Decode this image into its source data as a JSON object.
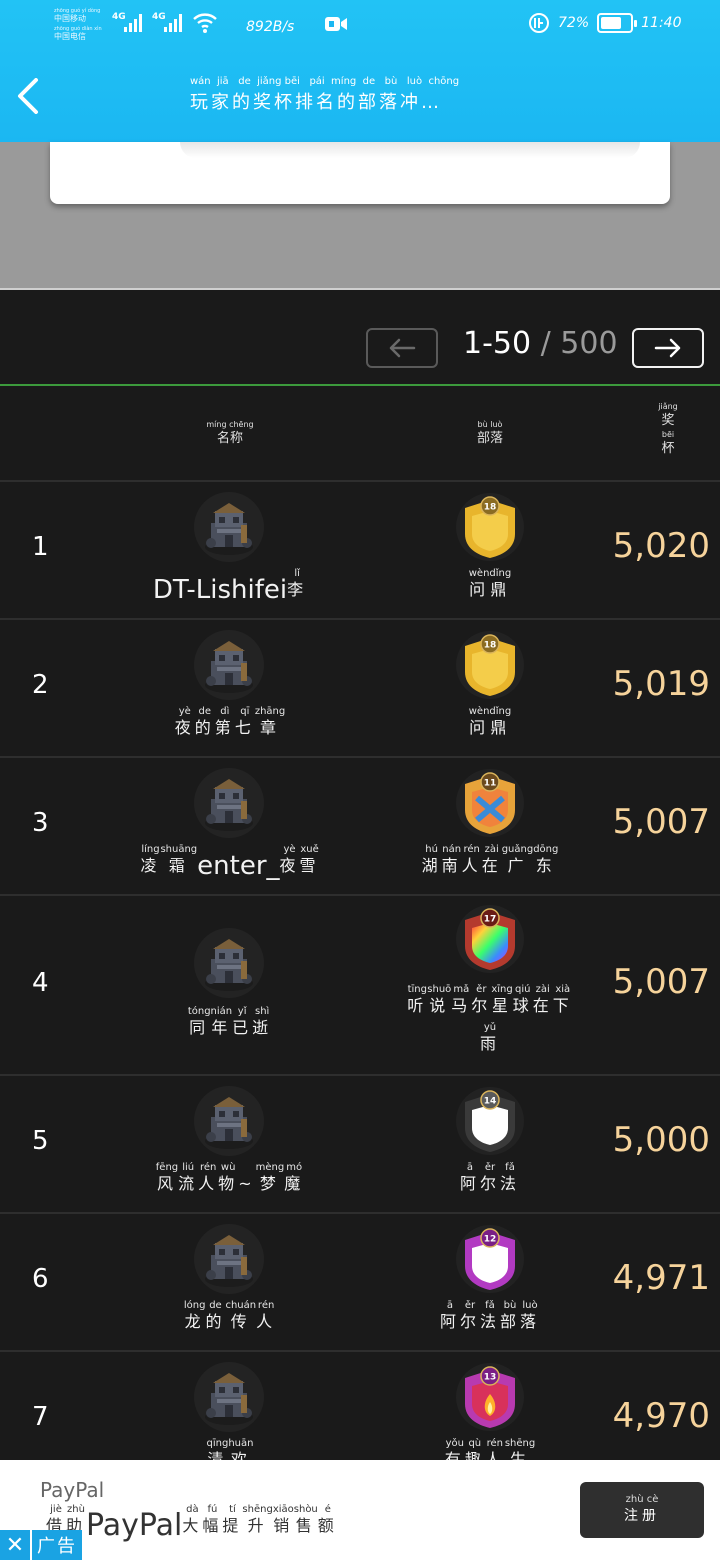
{
  "status_bar": {
    "carrier1": "中国移动",
    "carrier1_pinyin": "zhōng guó yí dòng",
    "carrier2": "中国电信",
    "carrier2_pinyin": "zhōng guó diàn xìn",
    "net1": "4G",
    "net2": "4G",
    "speed": "892B/s",
    "battery_percent": "72%",
    "battery_level": 0.72,
    "time": "11:40"
  },
  "header": {
    "title": "玩家的奖杯排名的部落冲…",
    "title_pinyin": "wán  jiā   de  jiǎng bēi   pái  míng  de   bù   luò  chōng"
  },
  "pager": {
    "range": "1-50",
    "slash": " / ",
    "total": "500"
  },
  "table": {
    "headers": {
      "name": "名称",
      "name_pinyin": "míng chēng",
      "clan": "部落",
      "clan_pinyin": "bù luò",
      "trophies_1": "奖",
      "trophies_1_pinyin": "jiǎng",
      "trophies_2": "杯",
      "trophies_2_pinyin": "bēi"
    },
    "rows": [
      {
        "rank": "1",
        "trophies": "5,020",
        "name_latin": "DT-Lishifei",
        "name_tail": "李",
        "name_tail_py": "lǐ",
        "clan_level": "18",
        "clan": [
          "问",
          "鼎"
        ],
        "clan_py": [
          "wèn",
          "dǐng"
        ]
      },
      {
        "rank": "2",
        "trophies": "5,019",
        "name": [
          "夜",
          "的",
          "第",
          "七",
          "章"
        ],
        "name_py": [
          "yè",
          "de",
          "dì",
          "qī",
          "zhāng"
        ],
        "clan_level": "18",
        "clan": [
          "问",
          "鼎"
        ],
        "clan_py": [
          "wèn",
          "dǐng"
        ]
      },
      {
        "rank": "3",
        "trophies": "5,007",
        "name_head": [
          "凌",
          "霜"
        ],
        "name_head_py": [
          "líng",
          "shuāng"
        ],
        "name_latin": "enter_",
        "name_tail2": [
          "夜",
          "雪"
        ],
        "name_tail2_py": [
          "yè",
          "xuě"
        ],
        "clan_level": "11",
        "clan": [
          "湖",
          "南",
          "人",
          "在",
          "广",
          "东"
        ],
        "clan_py": [
          "hú",
          "nán",
          "rén",
          "zài",
          "guǎng",
          "dōng"
        ]
      },
      {
        "rank": "4",
        "trophies": "5,007",
        "name": [
          "同",
          "年",
          "已",
          "逝"
        ],
        "name_py": [
          "tóng",
          "nián",
          "yǐ",
          "shì"
        ],
        "clan_level": "17",
        "clan": [
          "听",
          "说",
          "马",
          "尔",
          "星",
          "球",
          "在",
          "下"
        ],
        "clan_py": [
          "tīng",
          "shuō",
          "mǎ",
          "ěr",
          "xīng",
          "qiú",
          "zài",
          "xià"
        ],
        "clan2": [
          "雨"
        ],
        "clan2_py": [
          "yǔ"
        ]
      },
      {
        "rank": "5",
        "trophies": "5,000",
        "name": [
          "风",
          "流",
          "人",
          "物",
          "~",
          "梦",
          "魔"
        ],
        "name_py": [
          "fēng",
          "liú",
          "rén",
          "wù",
          "",
          "mèng",
          "mó"
        ],
        "clan_level": "14",
        "clan": [
          "阿",
          "尔",
          "法"
        ],
        "clan_py": [
          "ā",
          "ěr",
          "fǎ"
        ]
      },
      {
        "rank": "6",
        "trophies": "4,971",
        "name": [
          "龙",
          "的",
          "传",
          "人"
        ],
        "name_py": [
          "lóng",
          "de",
          "chuán",
          "rén"
        ],
        "clan_level": "12",
        "clan": [
          "阿",
          "尔",
          "法",
          "部",
          "落"
        ],
        "clan_py": [
          "ā",
          "ěr",
          "fǎ",
          "bù",
          "luò"
        ]
      },
      {
        "rank": "7",
        "trophies": "4,970",
        "name": [
          "清",
          "欢"
        ],
        "name_py": [
          "qīng",
          "huān"
        ],
        "clan_level": "13",
        "clan": [
          "有",
          "趣",
          "人",
          "生"
        ],
        "clan_py": [
          "yǒu",
          "qù",
          "rén",
          "shēng"
        ]
      }
    ]
  },
  "ad": {
    "title": "PayPal",
    "text_head": [
      "借",
      "助"
    ],
    "text_head_py": [
      "jiè",
      "zhù"
    ],
    "brand": "PayPal",
    "text_tail": [
      "大",
      "幅",
      "提",
      "升",
      "销",
      "售",
      "额"
    ],
    "text_tail_py": [
      "dà",
      "fú",
      "tí",
      "shēng",
      "xiāo",
      "shòu",
      "é"
    ],
    "button": "注册",
    "button_py": "zhù cè",
    "tag": "广告"
  },
  "colors": {
    "header_bg": "#1bb7f2",
    "trophy": "#f6d39b",
    "divider_green": "#3c9a3c"
  }
}
